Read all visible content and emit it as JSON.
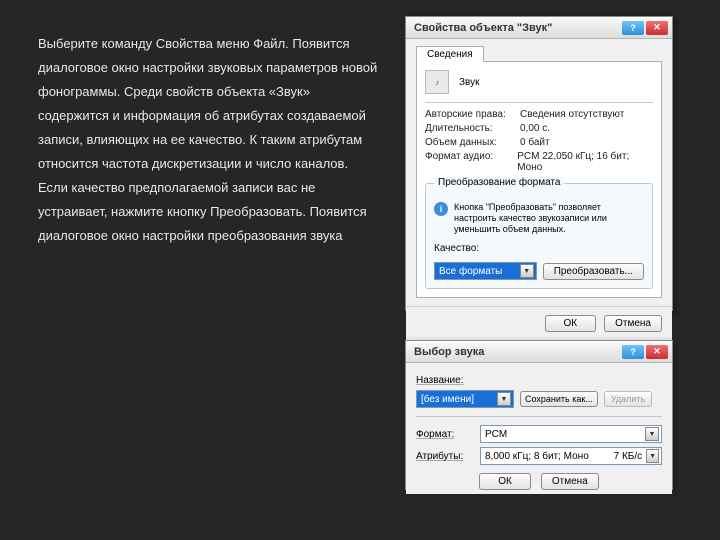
{
  "left_text": "Выберите команду Свойства меню Файл. Появится диалоговое окно настройки звуковых параметров новой фонограммы. Среди свойств объекта «Звук» содержится и информация об атрибутах создаваемой записи, влияющих на ее качество. К таким атрибутам относится частота дискретизации и число каналов. Если качество предполагаемой записи вас не устраивает, нажмите кнопку Преобразовать. Появится диалоговое окно настройки преобразования звука",
  "dialog1": {
    "title": "Свойства объекта \"Звук\"",
    "tab": "Сведения",
    "file_label": "Звук",
    "props": {
      "copyright_label": "Авторские права:",
      "copyright_value": "Сведения отсутствуют",
      "duration_label": "Длительность:",
      "duration_value": "0,00 с.",
      "size_label": "Объем данных:",
      "size_value": "0 байт",
      "format_label": "Формат аудио:",
      "format_value": "PCM 22,050 кГц; 16 бит; Моно"
    },
    "group_title": "Преобразование формата",
    "info_text": "Кнопка \"Преобразовать\" позволяет настроить качество звукозаписи или уменьшить объем данных.",
    "quality_label": "Качество:",
    "quality_value": "Все форматы",
    "convert_button": "Преобразовать...",
    "ok": "ОК",
    "cancel": "Отмена"
  },
  "dialog2": {
    "title": "Выбор звука",
    "name_label": "Название:",
    "name_value": "[без имени]",
    "save_as": "Сохранить как...",
    "delete": "Удалить",
    "format_label": "Формат:",
    "format_value": "PCM",
    "attr_label": "Атрибуты:",
    "attr_value": "8,000 кГц; 8 бит; Моно",
    "attr_rate": "7 КБ/с",
    "ok": "ОК",
    "cancel": "Отмена"
  }
}
